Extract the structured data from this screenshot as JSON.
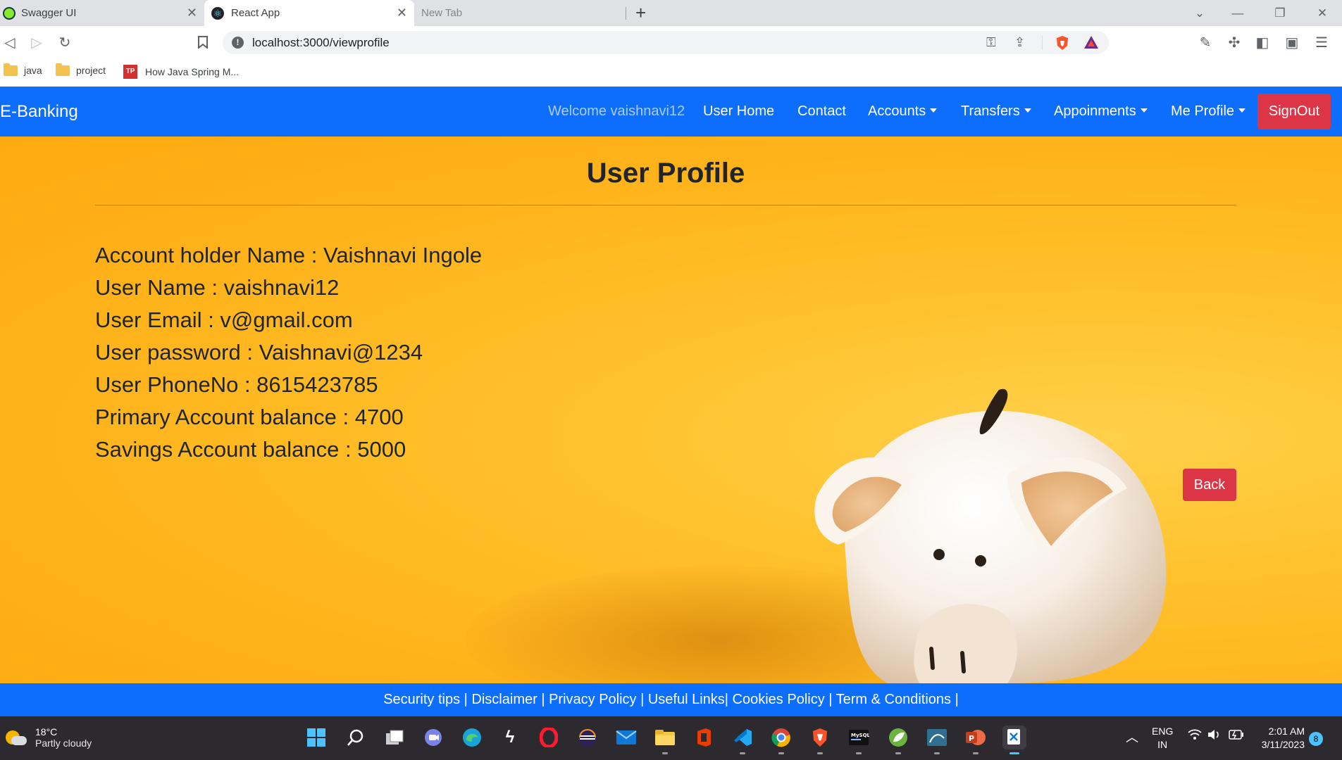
{
  "browser": {
    "tabs": [
      {
        "title": "Swagger UI",
        "active": false
      },
      {
        "title": "React App",
        "active": true
      },
      {
        "title": "New Tab",
        "active": false
      }
    ],
    "new_tab_symbol": "+",
    "address": "localhost:3000/viewprofile",
    "bookmarks": [
      {
        "label": "java",
        "icon": "folder-icon"
      },
      {
        "label": "project",
        "icon": "folder-icon"
      },
      {
        "label": "How Java Spring M...",
        "icon": "tp-icon"
      }
    ],
    "tp_badge": "TP"
  },
  "navbar": {
    "brand": "E-Banking",
    "welcome": "Welcome vaishnavi12",
    "items": [
      "User Home",
      "Contact",
      "Accounts",
      "Transfers",
      "Appoinments",
      "Me Profile"
    ],
    "signout_label": "SignOut"
  },
  "profile": {
    "title": "User Profile",
    "lines": [
      "Account holder Name : Vaishnavi Ingole",
      "User Name : vaishnavi12",
      "User Email : v@gmail.com",
      "User password : Vaishnavi@1234",
      "User PhoneNo : 8615423785",
      "Primary Account balance : 4700",
      "Savings Account balance : 5000"
    ],
    "back_label": "Back"
  },
  "footer": {
    "links": "Security tips | Disclaimer | Privacy Policy | Useful Links| Cookies Policy | Term & Conditions |"
  },
  "taskbar": {
    "weather_temp": "18°C",
    "weather_desc": "Partly cloudy",
    "lang_1": "ENG",
    "lang_2": "IN",
    "time": "2:01 AM",
    "date": "3/11/2023",
    "notifications": "8",
    "mysql_label": "MySQL"
  },
  "colors": {
    "primary": "#0d6efd",
    "danger": "#dc3545",
    "background": "#ffb81c"
  }
}
